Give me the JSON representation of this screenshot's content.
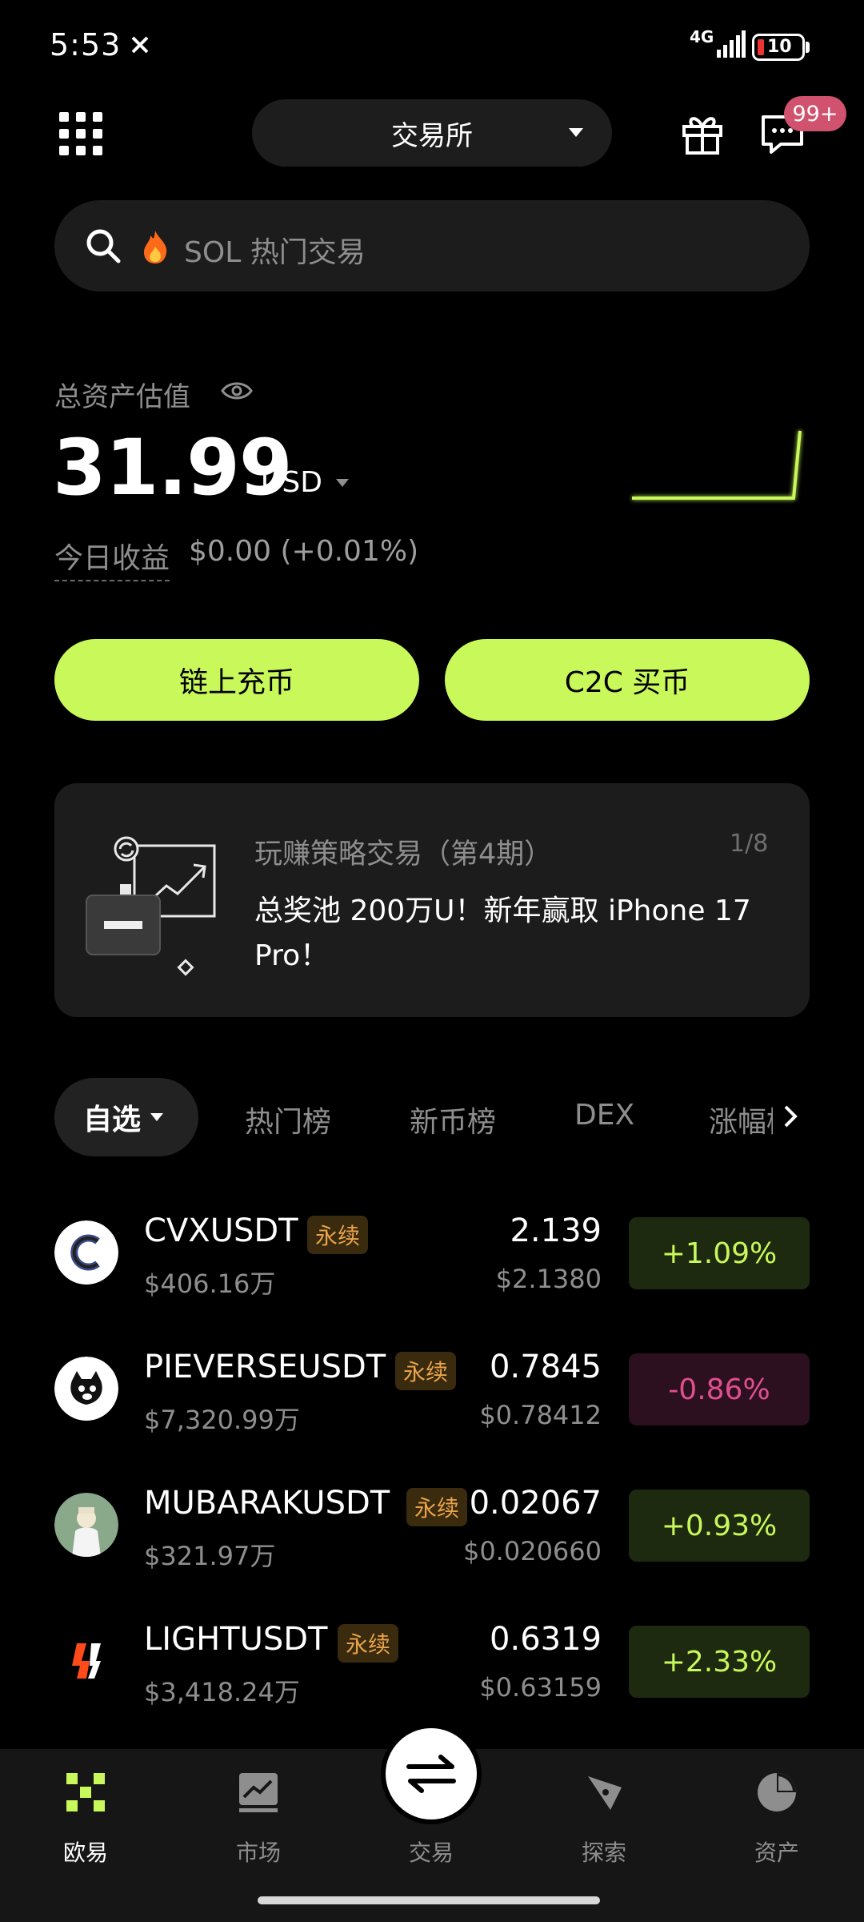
{
  "status_bar": {
    "time": "5:53",
    "network": "4G",
    "battery": "10"
  },
  "header": {
    "exchange_label": "交易所",
    "message_badge": "99+"
  },
  "search": {
    "placeholder": "SOL 热门交易"
  },
  "assets": {
    "label": "总资产估值",
    "value": "31.99",
    "unit": "USD",
    "pnl_label": "今日收益",
    "pnl_value": "$0.00 (+0.01%)"
  },
  "actions": {
    "deposit": "链上充币",
    "c2c": "C2C 买币"
  },
  "banner": {
    "title": "玩赚策略交易（第4期）",
    "page": "1/8",
    "description": "总奖池 200万U！新年赢取 iPhone 17 Pro！"
  },
  "tabs": {
    "watchlist": "自选",
    "items": [
      "热门榜",
      "新币榜",
      "DEX",
      "涨幅榜"
    ]
  },
  "market": {
    "perp_badge": "永续",
    "rows": [
      {
        "pair": "CVXUSDT",
        "volume": "$406.16万",
        "price": "2.139",
        "price_usd": "$2.1380",
        "change": "+1.09%",
        "direction": "up"
      },
      {
        "pair": "PIEVERSEUSDT",
        "volume": "$7,320.99万",
        "price": "0.7845",
        "price_usd": "$0.78412",
        "change": "-0.86%",
        "direction": "down"
      },
      {
        "pair": "MUBARAKUSDT",
        "volume": "$321.97万",
        "price": "0.02067",
        "price_usd": "$0.020660",
        "change": "+0.93%",
        "direction": "up"
      },
      {
        "pair": "LIGHTUSDT",
        "volume": "$3,418.24万",
        "price": "0.6319",
        "price_usd": "$0.63159",
        "change": "+2.33%",
        "direction": "up"
      }
    ]
  },
  "bottom_nav": {
    "home": "欧易",
    "market": "市场",
    "trade": "交易",
    "explore": "探索",
    "assets": "资产"
  },
  "colors": {
    "accent": "#c8f85a",
    "up": "#c8f85a",
    "down": "#e04f8f",
    "perp_text": "#e8a34a",
    "badge": "#d0526e"
  }
}
